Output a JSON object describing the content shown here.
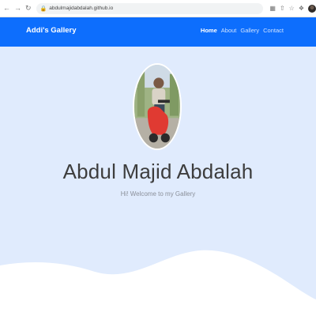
{
  "browser": {
    "url": "abdulmajidabdalah.github.io",
    "nav_icons": [
      "back-icon",
      "forward-icon",
      "reload-icon"
    ],
    "extension_icons": [
      "translate-icon",
      "share-icon",
      "star-icon",
      "puzzle-icon",
      "profile-avatar"
    ]
  },
  "navbar": {
    "brand": "Addi's Gallery",
    "links": [
      {
        "label": "Home",
        "active": true
      },
      {
        "label": "About",
        "active": false
      },
      {
        "label": "Gallery",
        "active": false
      },
      {
        "label": "Contact",
        "active": false
      }
    ],
    "color": "#0d6efd"
  },
  "hero": {
    "name": "Abdul Majid Abdalah",
    "tagline": "Hi! Welcome to my Gallery",
    "background": "#e0ebfd",
    "wave_color": "#ffffff"
  }
}
